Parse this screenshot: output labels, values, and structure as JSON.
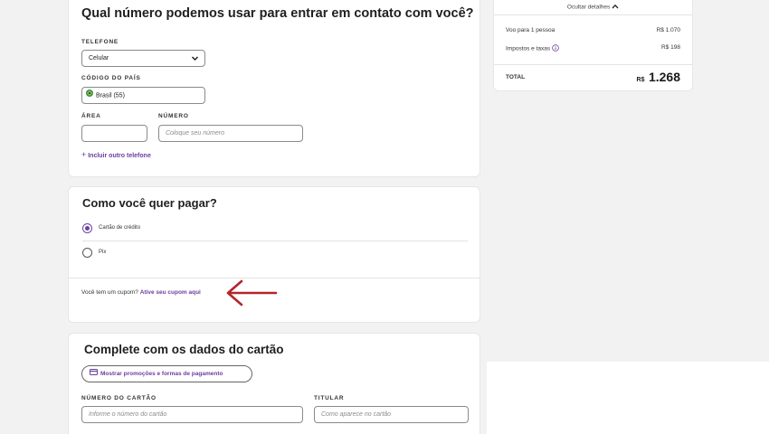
{
  "contact": {
    "title": "Qual número podemos usar para entrar em contato com você?",
    "phone_label": "TELEFONE",
    "phone_type": "Celular",
    "country_label": "CÓDIGO DO PAÍS",
    "country_value": "Brasil (55)",
    "area_label": "ÁREA",
    "number_label": "NÚMERO",
    "area_value": "",
    "number_placeholder": "Coloque seu número",
    "add_phone": "Incluir outro telefone"
  },
  "payment": {
    "title": "Como você quer pagar?",
    "options": [
      {
        "label": "Cartão de crédito",
        "selected": true
      },
      {
        "label": "Pix",
        "selected": false
      }
    ],
    "coupon_question": "Você tem um cupom?",
    "coupon_link": "Ative seu cupom aqui"
  },
  "card_form": {
    "title": "Complete com os dados do cartão",
    "promo_button": "Mostrar promoções e formas de pagamento",
    "card_number_label": "NÚMERO DO CARTÃO",
    "card_number_placeholder": "Informe o número do cartão",
    "holder_label": "TITULAR",
    "holder_placeholder": "Como aparece no cartão"
  },
  "summary": {
    "toggle": "Ocultar detalhes",
    "rows": [
      {
        "label": "Voo para 1 pessoa",
        "value": "R$ 1.070"
      },
      {
        "label": "Impostos e taxas",
        "value": "R$ 198"
      }
    ],
    "total_label": "TOTAL",
    "total_currency": "R$",
    "total_value": "1.268"
  },
  "colors": {
    "accent": "#6b3fa0",
    "annotation_arrow": "#b3262b"
  },
  "icons": [
    "chevron-down-icon",
    "brazil-flag-icon",
    "plus-icon",
    "info-icon",
    "chevron-up-icon",
    "card-icon",
    "red-arrow-icon"
  ]
}
